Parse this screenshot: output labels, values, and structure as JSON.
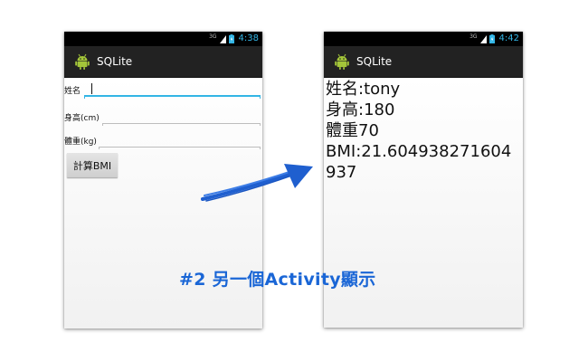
{
  "screen1": {
    "status": {
      "network": "3G",
      "time": "4:38"
    },
    "app_title": "SQLite",
    "form": {
      "name_label": "姓名",
      "height_label": "身高(cm)",
      "weight_label": "體重(kg)",
      "name_value": "",
      "height_value": "",
      "weight_value": ""
    },
    "button_label": "計算BMI"
  },
  "screen2": {
    "status": {
      "network": "3G",
      "time": "4:42"
    },
    "app_title": "SQLite",
    "result": {
      "name_line": "姓名:tony",
      "height_line": "身高:180",
      "weight_line": "體重70",
      "bmi_line_1": "BMI:21.604938271604",
      "bmi_line_2": "937"
    }
  },
  "caption": "#2 另一個Activity顯示",
  "colors": {
    "accent": "#33b5e5",
    "actionbar": "#222222",
    "caption": "#1a66d6",
    "arrow": "#1f5fcf",
    "android_green": "#a4c639"
  },
  "icons": [
    "android-app-icon",
    "signal-icon",
    "battery-icon",
    "arrow-icon"
  ]
}
